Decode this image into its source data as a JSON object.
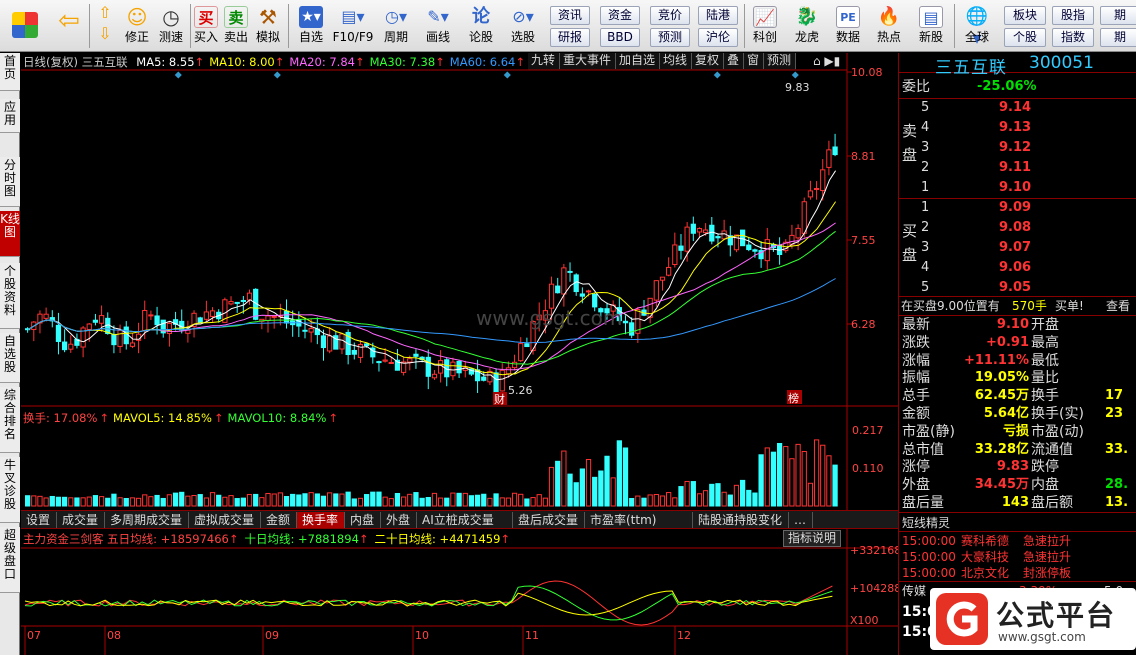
{
  "toolbar": {
    "buttons": [
      {
        "label": "",
        "icon": "windows-grid-icon"
      },
      {
        "label": "",
        "icon": "back-arrow-icon"
      },
      {
        "label": "修正",
        "icon": "updown-arrows-icon"
      },
      {
        "label": "测速",
        "icon": "clock-icon"
      },
      {
        "label": "买入",
        "icon": "buy-icon",
        "glyph": "买"
      },
      {
        "label": "卖出",
        "icon": "sell-icon",
        "glyph": "卖"
      },
      {
        "label": "模拟",
        "icon": "gavel-icon"
      },
      {
        "label": "自选",
        "icon": "star-icon"
      },
      {
        "label": "F10/F9",
        "icon": "f10-icon"
      },
      {
        "label": "周期",
        "icon": "period-icon"
      },
      {
        "label": "画线",
        "icon": "pencil-icon"
      },
      {
        "label": "论股",
        "icon": "forum-icon",
        "glyph": "论"
      },
      {
        "label": "选股",
        "icon": "select-stock-icon"
      },
      {
        "label": "科创",
        "icon": "star-market-icon"
      },
      {
        "label": "龙虎",
        "icon": "dragon-tiger-icon"
      },
      {
        "label": "数据",
        "icon": "pe-icon",
        "glyph": "PE"
      },
      {
        "label": "热点",
        "icon": "hot-icon"
      },
      {
        "label": "新股",
        "icon": "ipo-icon"
      },
      {
        "label": "全球",
        "icon": "globe-icon"
      }
    ],
    "small_buttons": [
      "资讯",
      "资金",
      "竞价",
      "陆港",
      "研报",
      "BBD",
      "预测",
      "沪伦",
      "板块",
      "股指",
      "期",
      "个股",
      "指数",
      "期"
    ]
  },
  "leftnav": [
    "首页",
    "应用",
    "分时图",
    "K线图",
    "个股资料",
    "自选股",
    "综合排名",
    "牛叉诊股",
    "超级盘口"
  ],
  "chart": {
    "header_prefix": "日线(复权)",
    "stock_name": "三五互联",
    "ma": [
      {
        "label": "MA5: 8.55",
        "color": "#ffffff"
      },
      {
        "label": "MA10: 8.00",
        "color": "#ffff00"
      },
      {
        "label": "MA20: 7.84",
        "color": "#ff66ff"
      },
      {
        "label": "MA30: 7.38",
        "color": "#33ff33"
      },
      {
        "label": "MA60: 6.64",
        "color": "#3399ff"
      }
    ],
    "header_tabs": [
      "九转",
      "重大事件",
      "加自选",
      "均线",
      "复权",
      "叠",
      "窗",
      "预测"
    ],
    "price_ticks": [
      "10.08",
      "8.81",
      "7.55",
      "6.28"
    ],
    "high_label": "9.83",
    "low_label": "5.26",
    "cai_label": "财",
    "bang_label": "榜",
    "watermark": "www.gsgt.com",
    "vol_header": [
      {
        "label": "换手: 17.08%",
        "color": "#ff4444"
      },
      {
        "label": "MAVOL5: 14.85%",
        "color": "#ffff00"
      },
      {
        "label": "MAVOL10: 8.84%",
        "color": "#33ff33"
      }
    ],
    "vol_ticks": [
      "0.217",
      "0.110"
    ],
    "bottom_tabs": [
      "设置",
      "成交量",
      "多周期成交量",
      "虚拟成交量",
      "金额",
      "换手率",
      "内盘",
      "外盘",
      "AI立桩成交量",
      "盘后成交量",
      "市盈率(ttm)",
      "陆股通持股变化",
      "…"
    ],
    "active_bottom_tab": "换手率",
    "ind_header": [
      {
        "label": "主力资金三剑客 五日均线: +18597466",
        "color": "#ff4444"
      },
      {
        "label": "十日均线: +7881894",
        "color": "#33ff33"
      },
      {
        "label": "二十日均线: +4471459",
        "color": "#ffff00"
      }
    ],
    "ind_button": "指标说明",
    "ind_ticks": [
      "+332168",
      "+104288",
      "X100"
    ],
    "months": [
      "07",
      "08",
      "09",
      "10",
      "11",
      "12"
    ]
  },
  "quote": {
    "name": "三五互联",
    "code": "300051",
    "weibi_label": "委比",
    "weibi_value": "-25.06%",
    "sell_label": "卖盘",
    "buy_label": "买盘",
    "asks": [
      {
        "n": "5",
        "p": "9.14"
      },
      {
        "n": "4",
        "p": "9.13"
      },
      {
        "n": "3",
        "p": "9.12"
      },
      {
        "n": "2",
        "p": "9.11"
      },
      {
        "n": "1",
        "p": "9.10"
      }
    ],
    "bids": [
      {
        "n": "1",
        "p": "9.09"
      },
      {
        "n": "2",
        "p": "9.08"
      },
      {
        "n": "3",
        "p": "9.07"
      },
      {
        "n": "4",
        "p": "9.06"
      },
      {
        "n": "5",
        "p": "9.05"
      }
    ],
    "notice_text": "在买盘9.00位置有",
    "notice_vol": "570手",
    "notice_tail": "买单!",
    "notice_link": "查看",
    "stats": [
      {
        "l": "最新",
        "v": "9.10",
        "c": "red",
        "l2": "开盘",
        "v2": ""
      },
      {
        "l": "涨跌",
        "v": "+0.91",
        "c": "red",
        "l2": "最高",
        "v2": ""
      },
      {
        "l": "涨幅",
        "v": "+11.11%",
        "c": "red",
        "l2": "最低",
        "v2": ""
      },
      {
        "l": "振幅",
        "v": "19.05%",
        "c": "yel",
        "l2": "量比",
        "v2": ""
      },
      {
        "l": "总手",
        "v": "62.45万",
        "c": "yel",
        "l2": "换手",
        "v2": "17"
      },
      {
        "l": "金额",
        "v": "5.64亿",
        "c": "yel",
        "l2": "换手(实)",
        "v2": "23"
      },
      {
        "l": "市盈(静)",
        "v": "亏损",
        "c": "yel",
        "l2": "市盈(动)",
        "v2": ""
      },
      {
        "l": "总市值",
        "v": "33.28亿",
        "c": "yel",
        "l2": "流通值",
        "v2": "33."
      },
      {
        "l": "涨停",
        "v": "9.83",
        "c": "red",
        "l2": "跌停",
        "v2": ""
      },
      {
        "l": "外盘",
        "v": "34.45万",
        "c": "red",
        "l2": "内盘",
        "v2": "28."
      },
      {
        "l": "盘后量",
        "v": "143",
        "c": "yel",
        "l2": "盘后额",
        "v2": "13."
      }
    ],
    "news_title": "短线精灵",
    "news": [
      {
        "t": "15:00:00",
        "s": "赛科希德",
        "e": "急速拉升"
      },
      {
        "t": "15:00:00",
        "s": "大豪科技",
        "e": "急速拉升"
      },
      {
        "t": "15:00:00",
        "s": "北京文化",
        "e": "封涨停板"
      }
    ],
    "sector_label": "传媒",
    "sector_value": "3.39%",
    "sector_tail": "5.0",
    "time1": "15:0",
    "time2": "15:0"
  },
  "logo": {
    "brand": "公式平台",
    "url": "www.gsgt.com"
  }
}
